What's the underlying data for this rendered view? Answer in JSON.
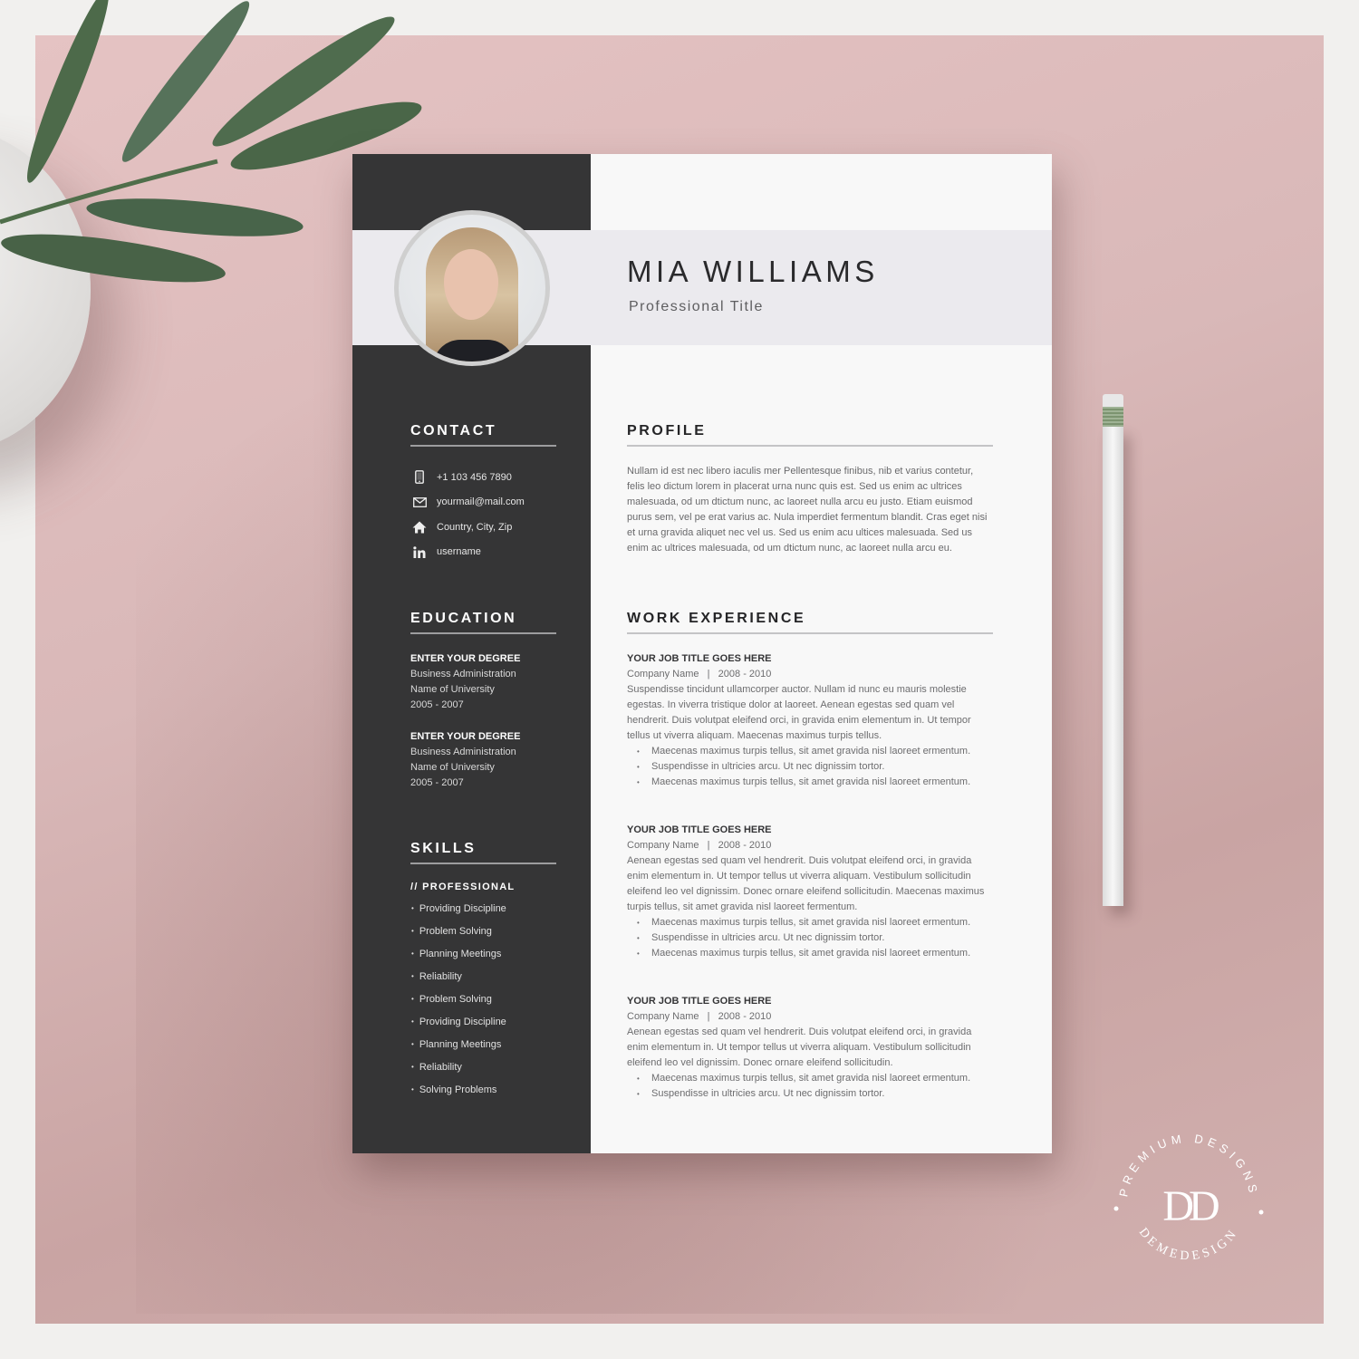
{
  "resume": {
    "name": "MIA WILLIAMS",
    "professional_title": "Professional Title",
    "contact": {
      "heading": "CONTACT",
      "items": [
        {
          "icon": "phone-icon",
          "text": "+1 103 456 7890"
        },
        {
          "icon": "mail-icon",
          "text": "yourmail@mail.com"
        },
        {
          "icon": "home-icon",
          "text": "Country, City, Zip"
        },
        {
          "icon": "linkedin-icon",
          "text": "username"
        }
      ]
    },
    "education": {
      "heading": "EDUCATION",
      "items": [
        {
          "degree": "ENTER YOUR DEGREE",
          "field": "Business Administration",
          "school": "Name of University",
          "years": "2005 - 2007"
        },
        {
          "degree": "ENTER YOUR DEGREE",
          "field": "Business Administration",
          "school": "Name of University",
          "years": "2005 - 2007"
        }
      ]
    },
    "skills": {
      "heading": "SKILLS",
      "subheading": "// PROFESSIONAL",
      "items": [
        "Providing Discipline",
        "Problem Solving",
        "Planning Meetings",
        "Reliability",
        "Problem Solving",
        "Providing Discipline",
        "Planning Meetings",
        "Reliability",
        "Solving Problems"
      ]
    },
    "profile": {
      "heading": "PROFILE",
      "text": "Nullam id est nec libero iaculis mer Pellentesque finibus, nib et varius contetur, felis leo dictum lorem in placerat urna nunc quis est. Sed us enim ac ultrices malesuada, od um dtictum nunc, ac laoreet nulla arcu eu justo. Etiam euismod purus sem, vel pe erat varius ac. Nula imperdiet fermentum blandit. Cras eget nisi et urna gravida aliquet nec vel us. Sed us enim acu ultices malesuada. Sed us enim ac ultrices malesuada, od um dtictum nunc, ac laoreet nulla arcu eu."
    },
    "work": {
      "heading": "WORK EXPERIENCE",
      "jobs": [
        {
          "title": "YOUR JOB TITLE GOES HERE",
          "meta": "Company Name   |   2008 - 2010",
          "desc": "Suspendisse tincidunt ullamcorper auctor. Nullam id nunc eu mauris molestie egestas. In viverra tristique dolor at laoreet. Aenean egestas sed quam vel hendrerit. Duis volutpat eleifend orci, in gravida enim elementum in. Ut tempor tellus ut viverra aliquam. Maecenas maximus turpis tellus.",
          "bullets": [
            "Maecenas maximus turpis tellus, sit amet gravida nisl laoreet ermentum.",
            "Suspendisse in ultricies arcu. Ut nec dignissim tortor.",
            "Maecenas maximus turpis tellus, sit amet gravida nisl laoreet ermentum."
          ]
        },
        {
          "title": "YOUR JOB TITLE GOES HERE",
          "meta": "Company Name   |   2008 - 2010",
          "desc": "Aenean egestas sed quam vel hendrerit. Duis volutpat eleifend orci, in gravida enim elementum in. Ut tempor tellus ut viverra aliquam. Vestibulum sollicitudin eleifend leo vel dignissim. Donec ornare eleifend sollicitudin. Maecenas maximus turpis tellus, sit amet gravida nisl laoreet fermentum.",
          "bullets": [
            "Maecenas maximus turpis tellus, sit amet gravida nisl laoreet ermentum.",
            "Suspendisse in ultricies arcu. Ut nec dignissim tortor.",
            "Maecenas maximus turpis tellus, sit amet gravida nisl laoreet ermentum."
          ]
        },
        {
          "title": "YOUR JOB TITLE GOES HERE",
          "meta": "Company Name   |   2008 - 2010",
          "desc": "Aenean egestas sed quam vel hendrerit. Duis volutpat eleifend orci, in gravida enim elementum in. Ut tempor tellus ut viverra aliquam. Vestibulum sollicitudin eleifend leo vel dignissim. Donec ornare eleifend sollicitudin.",
          "bullets": [
            "Maecenas maximus turpis tellus, sit amet gravida nisl laoreet ermentum.",
            "Suspendisse in ultricies arcu. Ut nec dignissim tortor."
          ]
        }
      ]
    }
  },
  "badge": {
    "top_text": "PREMIUM DESIGNS",
    "bottom_text": "DEMEDESIGN",
    "monogram": "DD"
  },
  "colors": {
    "sidebar": "#353536",
    "header_band": "#ebeaee",
    "page": "#f8f8f8",
    "backdrop_pink": "#dcbcbc"
  }
}
